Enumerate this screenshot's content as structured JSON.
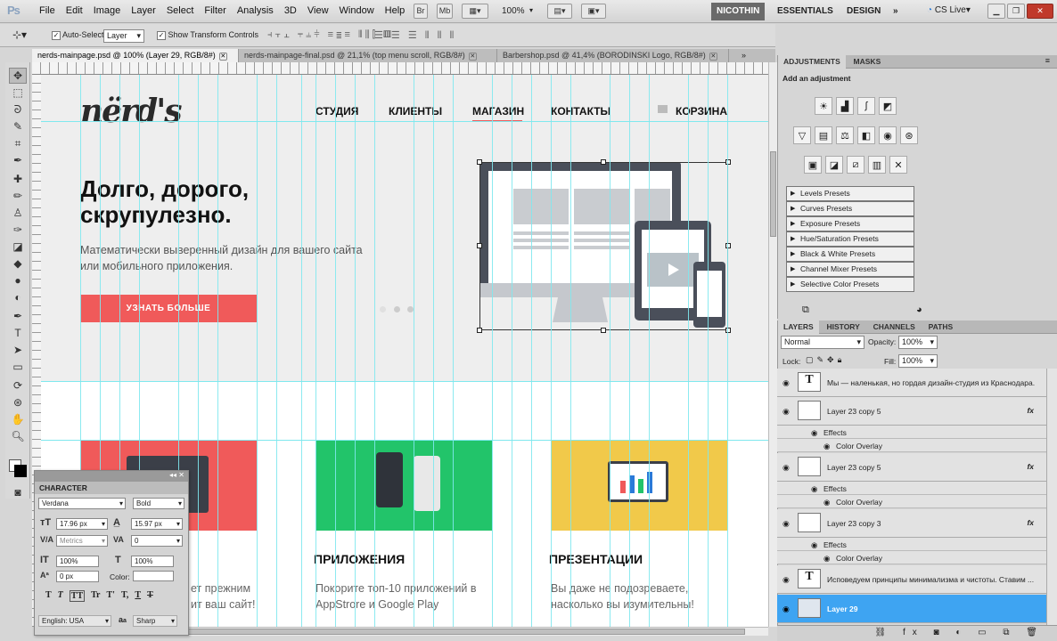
{
  "app": {
    "logo": "Ps",
    "menu": [
      "File",
      "Edit",
      "Image",
      "Layer",
      "Select",
      "Filter",
      "Analysis",
      "3D",
      "View",
      "Window",
      "Help"
    ],
    "bridge": "Br",
    "minibridge": "Mb",
    "zoom": "100%",
    "workspaces": {
      "active": "NICOTHIN",
      "other1": "ESSENTIALS",
      "other2": "DESIGN"
    },
    "cslive": "CS Live"
  },
  "options": {
    "auto_select_label": "Auto-Select:",
    "auto_select_value": "Layer",
    "transform_label": "Show Transform Controls"
  },
  "tabs": [
    {
      "label": "nerds-mainpage.psd @ 100% (Layer 29, RGB/8#)"
    },
    {
      "label": "nerds-mainpage-final.psd @ 21,1% (top menu scroll, RGB/8#)"
    },
    {
      "label": "Barbershop.psd @ 41,4% (BORODINSKI Logo, RGB/8#)"
    }
  ],
  "site": {
    "logo": "nërd's",
    "nav": [
      "СТУДИЯ",
      "КЛИЕНТЫ",
      "МАГАЗИН",
      "КОНТАКТЫ",
      "КОРЗИНА"
    ],
    "hero_title": "Долго, дорого, скрупулезно.",
    "hero_sub": "Математически выверенный дизайн для вашего сайта или мобильного приложения.",
    "cta": "УЗНАТЬ БОЛЬШЕ",
    "cards": [
      {
        "title": "",
        "text_partial_1": "ет прежним",
        "text_partial_2": "ит ваш сайт!",
        "color": "#f05a5a"
      },
      {
        "title": "ПРИЛОЖЕНИЯ",
        "text": "Покорите топ-10 приложений в AppStrore и Google Play",
        "color": "#22c46a"
      },
      {
        "title": "ПРЕЗЕНТАЦИИ",
        "text": "Вы даже не подозреваете, насколько вы изумительны!",
        "color": "#f1c94a"
      }
    ]
  },
  "adjustments": {
    "tabs": [
      "ADJUSTMENTS",
      "MASKS"
    ],
    "header": "Add an adjustment",
    "presets": [
      "Levels Presets",
      "Curves Presets",
      "Exposure Presets",
      "Hue/Saturation Presets",
      "Black & White Presets",
      "Channel Mixer Presets",
      "Selective Color Presets"
    ]
  },
  "layers": {
    "tabs": [
      "LAYERS",
      "HISTORY",
      "CHANNELS",
      "PATHS"
    ],
    "blend": "Normal",
    "opacity_label": "Opacity:",
    "opacity": "100%",
    "lock_label": "Lock:",
    "fill_label": "Fill:",
    "fill": "100%",
    "items": [
      {
        "name": "Мы — наленькая, но гордая дизайн-студия из Краснодара."
      },
      {
        "name": "Layer 23 copy 5",
        "fx": "fx",
        "effects": "Effects",
        "overlay": "Color Overlay"
      },
      {
        "name": "Layer 23 copy 5",
        "fx": "fx",
        "effects": "Effects",
        "overlay": "Color Overlay"
      },
      {
        "name": "Layer 23 copy 3",
        "fx": "fx",
        "effects": "Effects",
        "overlay": "Color Overlay"
      },
      {
        "name": "Исповедуем принципы минимализма и чистоты. Ставим ..."
      },
      {
        "name": "Layer 29"
      }
    ]
  },
  "character": {
    "title": "CHARACTER",
    "font": "Verdana",
    "style": "Bold",
    "size": "17.96 px",
    "leading": "15.97 px",
    "kerning": "Metrics",
    "tracking": "0",
    "vscale": "100%",
    "hscale": "100%",
    "baseline": "0 px",
    "color_label": "Color:",
    "lang": "English: USA",
    "aa": "Sharp",
    "aa_label": "a",
    "styles": [
      "T",
      "T",
      "TT",
      "Tr",
      "T'",
      "T,",
      "T",
      "T"
    ]
  }
}
